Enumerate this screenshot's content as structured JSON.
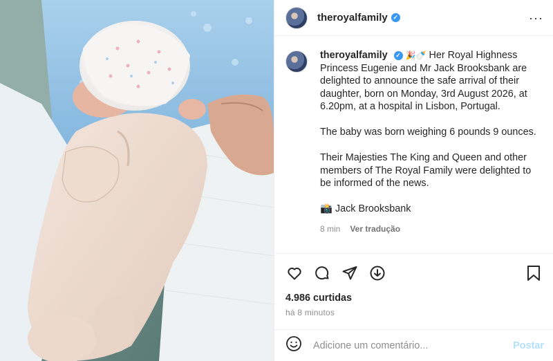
{
  "post": {
    "username": "theroyalfamily",
    "caption_username": "theroyalfamily",
    "caption_emoji": "🎉🍼",
    "caption_paragraphs": [
      "Her Royal Highness Princess Eugenie and Mr Jack Brooksbank are delighted to announce the safe arrival of their daughter, born on Monday, 3rd August 2026, at 6.20pm, at a hospital in Lisbon, Portugal.",
      "The baby was born weighing 6 pounds 9 ounces.",
      "Their Majesties The King and Queen and other members of The Royal Family were delighted to be informed of the news."
    ],
    "photo_credit": "📸 Jack Brooksbank",
    "caption_age": "8 min",
    "translate_label": "Ver tradução",
    "likes": "4.986 curtidas",
    "timestamp": "há 8 minutos",
    "comment_placeholder": "Adicione um comentário...",
    "post_button": "Postar"
  },
  "icons": {
    "like": "heart-icon",
    "comment": "comment-icon",
    "share": "share-icon",
    "download": "download-icon",
    "save": "bookmark-icon",
    "emoji": "smiley-icon",
    "more": "more-icon",
    "verified": "verified-badge-icon"
  },
  "colors": {
    "verified": "#3897f0",
    "post_button": "#b2dffc",
    "muted_text": "#8e8e8e"
  }
}
